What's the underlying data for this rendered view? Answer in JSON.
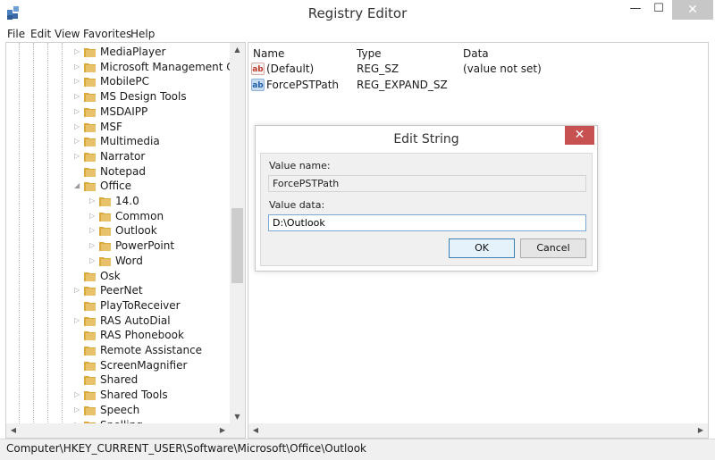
{
  "window": {
    "title": "Registry Editor",
    "minimize_glyph": "—",
    "maximize_glyph": "☐",
    "close_glyph": "✕"
  },
  "menu": [
    "File",
    "Edit",
    "View",
    "Favorites",
    "Help"
  ],
  "tree": {
    "items": [
      {
        "label": "MediaPlayer",
        "level": 0,
        "expander": "▷"
      },
      {
        "label": "Microsoft Management Cor",
        "level": 0,
        "expander": "▷"
      },
      {
        "label": "MobilePC",
        "level": 0,
        "expander": "▷"
      },
      {
        "label": "MS Design Tools",
        "level": 0,
        "expander": "▷"
      },
      {
        "label": "MSDAIPP",
        "level": 0,
        "expander": "▷"
      },
      {
        "label": "MSF",
        "level": 0,
        "expander": "▷"
      },
      {
        "label": "Multimedia",
        "level": 0,
        "expander": "▷"
      },
      {
        "label": "Narrator",
        "level": 0,
        "expander": "▷"
      },
      {
        "label": "Notepad",
        "level": 0,
        "expander": ""
      },
      {
        "label": "Office",
        "level": 0,
        "expander": "◢"
      },
      {
        "label": "14.0",
        "level": 1,
        "expander": "▷"
      },
      {
        "label": "Common",
        "level": 1,
        "expander": "▷"
      },
      {
        "label": "Outlook",
        "level": 1,
        "expander": "▷"
      },
      {
        "label": "PowerPoint",
        "level": 1,
        "expander": "▷"
      },
      {
        "label": "Word",
        "level": 1,
        "expander": "▷"
      },
      {
        "label": "Osk",
        "level": 0,
        "expander": ""
      },
      {
        "label": "PeerNet",
        "level": 0,
        "expander": "▷"
      },
      {
        "label": "PlayToReceiver",
        "level": 0,
        "expander": ""
      },
      {
        "label": "RAS AutoDial",
        "level": 0,
        "expander": "▷"
      },
      {
        "label": "RAS Phonebook",
        "level": 0,
        "expander": ""
      },
      {
        "label": "Remote Assistance",
        "level": 0,
        "expander": ""
      },
      {
        "label": "ScreenMagnifier",
        "level": 0,
        "expander": ""
      },
      {
        "label": "Shared",
        "level": 0,
        "expander": ""
      },
      {
        "label": "Shared Tools",
        "level": 0,
        "expander": "▷"
      },
      {
        "label": "Speech",
        "level": 0,
        "expander": "▷"
      },
      {
        "label": "Spelling",
        "level": 0,
        "expander": "▷"
      }
    ]
  },
  "scroll": {
    "up": "▲",
    "down": "▼",
    "left": "◀",
    "right": "▶"
  },
  "list": {
    "columns": [
      "Name",
      "Type",
      "Data"
    ],
    "rows": [
      {
        "name": "(Default)",
        "type": "REG_SZ",
        "data": "(value not set)",
        "icon": "string-value-icon",
        "icon_text": "ab"
      },
      {
        "name": "ForcePSTPath",
        "type": "REG_EXPAND_SZ",
        "data": "",
        "icon": "expand-string-value-icon",
        "icon_text": "ab"
      }
    ]
  },
  "dialog": {
    "title": "Edit String",
    "close_glyph": "✕",
    "value_name_label": "Value name:",
    "value_name": "ForcePSTPath",
    "value_data_label": "Value data:",
    "value_data": "D:\\Outlook",
    "ok_label": "OK",
    "cancel_label": "Cancel"
  },
  "status": {
    "path": "Computer\\HKEY_CURRENT_USER\\Software\\Microsoft\\Office\\Outlook"
  },
  "colors": {
    "folder": "#e8c26a",
    "dialog_close": "#c75050",
    "ok_border": "#3c7fb1"
  }
}
